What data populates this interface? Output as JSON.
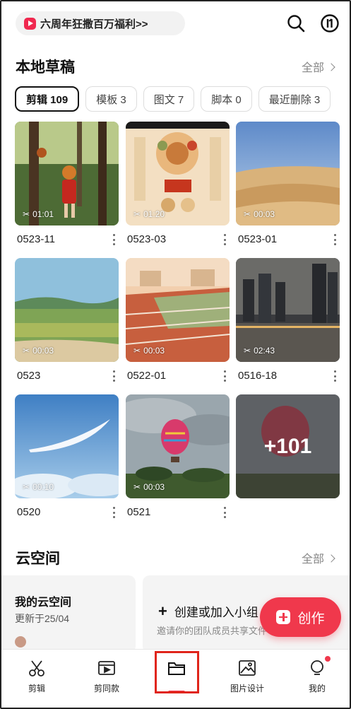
{
  "header": {
    "promo_text": "六周年狂撒百万福利>>",
    "promo_icon": "play-badge-icon",
    "search_icon": "search-icon",
    "stats_icon": "stats-circle-icon"
  },
  "drafts": {
    "title": "本地草稿",
    "more_label": "全部",
    "chips": [
      {
        "label": "剪辑 109",
        "active": true
      },
      {
        "label": "模板 3"
      },
      {
        "label": "图文 7"
      },
      {
        "label": "脚本 0"
      },
      {
        "label": "最近删除 3"
      }
    ],
    "items": [
      {
        "name": "0523-11",
        "duration": "01:01",
        "thumb": "girl-squirrel-forest"
      },
      {
        "name": "0523-03",
        "duration": "01:20",
        "thumb": "poster-food"
      },
      {
        "name": "0523-01",
        "duration": "00:03",
        "thumb": "desert"
      },
      {
        "name": "0523",
        "duration": "00:03",
        "thumb": "farmland"
      },
      {
        "name": "0522-01",
        "duration": "00:03",
        "thumb": "running-track"
      },
      {
        "name": "0516-18",
        "duration": "02:43",
        "thumb": "city-night"
      },
      {
        "name": "0520",
        "duration": "00:10",
        "thumb": "feather-sky"
      },
      {
        "name": "0521",
        "duration": "00:03",
        "thumb": "hot-air-balloon"
      }
    ],
    "more_overlay": "+101"
  },
  "cloud": {
    "title": "云空间",
    "more_label": "全部",
    "my_space_title": "我的云空间",
    "my_space_sub": "更新于25/04",
    "create_team_title": "创建或加入小组",
    "create_team_sub": "邀请你的团队成员共享文件"
  },
  "fab": {
    "label": "创作"
  },
  "tabs": [
    {
      "label": "剪辑",
      "icon": "scissors-icon"
    },
    {
      "label": "剪同款",
      "icon": "template-film-icon"
    },
    {
      "label": "",
      "icon": "folder-icon",
      "active": true
    },
    {
      "label": "图片设计",
      "icon": "image-design-icon"
    },
    {
      "label": "我的",
      "icon": "profile-icon",
      "badge": true
    }
  ],
  "colors": {
    "accent": "#f0384c",
    "highlight": "#e0251b"
  }
}
